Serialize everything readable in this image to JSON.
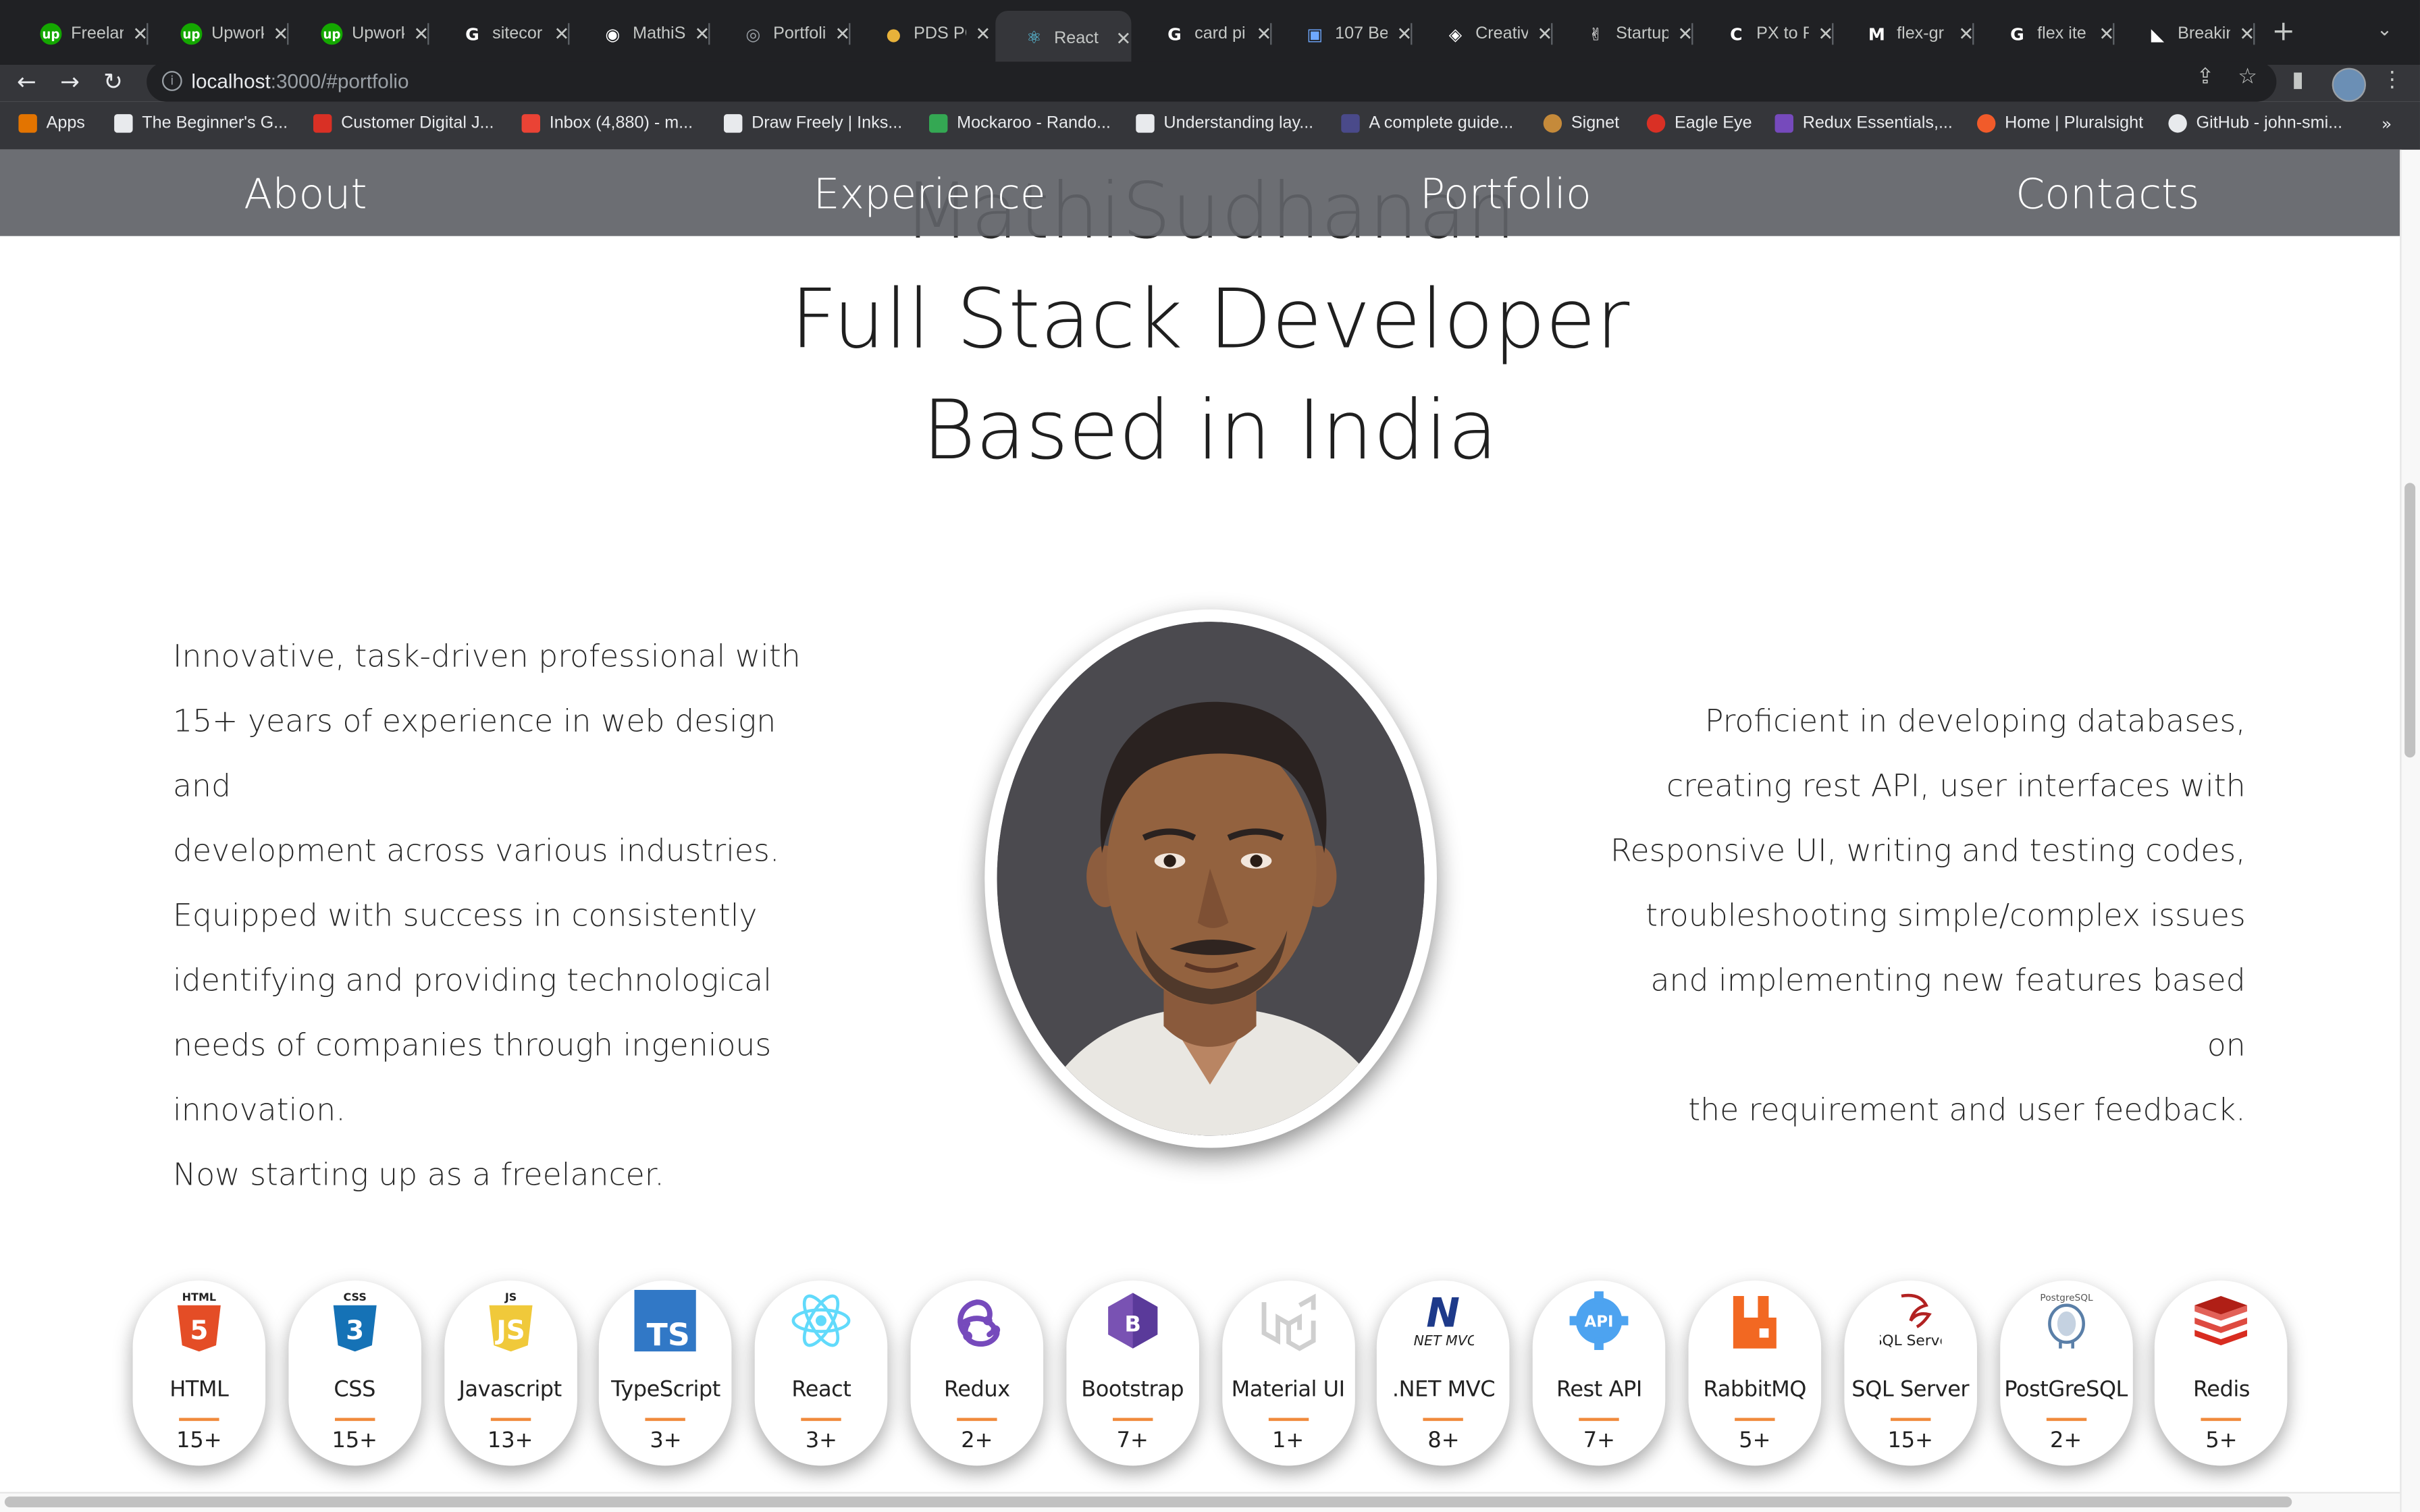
{
  "browser": {
    "tabs": [
      {
        "title": "Freelar",
        "icon": "upwork-icon",
        "color": "#14a800",
        "glyph": "up"
      },
      {
        "title": "Upwork",
        "icon": "upwork-icon",
        "color": "#14a800",
        "glyph": "up"
      },
      {
        "title": "Upwork",
        "icon": "upwork-icon",
        "color": "#14a800",
        "glyph": "up"
      },
      {
        "title": "sitecor",
        "icon": "google-icon",
        "color": "#ffffff",
        "glyph": "G"
      },
      {
        "title": "MathiS",
        "icon": "github-icon",
        "color": "#ffffff",
        "glyph": "◉"
      },
      {
        "title": "Portfoli",
        "icon": "globe-icon",
        "color": "#9aa0a6",
        "glyph": "◎"
      },
      {
        "title": "PDS PC",
        "icon": "pds-icon",
        "color": "#e8b23a",
        "glyph": "●"
      },
      {
        "title": "React",
        "icon": "react-icon",
        "color": "#61dafb",
        "glyph": "⚛"
      },
      {
        "title": "card pi",
        "icon": "google-icon",
        "color": "#ffffff",
        "glyph": "G"
      },
      {
        "title": "107 Be",
        "icon": "image-icon",
        "color": "#6ea8fe",
        "glyph": "▣"
      },
      {
        "title": "Creativ",
        "icon": "codepen-icon",
        "color": "#ffffff",
        "glyph": "◈"
      },
      {
        "title": "Startup",
        "icon": "startup-icon",
        "color": "#ffffff",
        "glyph": "✌"
      },
      {
        "title": "PX to R",
        "icon": "c-icon",
        "color": "#ffffff",
        "glyph": "C"
      },
      {
        "title": "flex-gr",
        "icon": "medium-icon",
        "color": "#ffffff",
        "glyph": "M"
      },
      {
        "title": "flex ite",
        "icon": "google-icon",
        "color": "#ffffff",
        "glyph": "G"
      },
      {
        "title": "Breakin",
        "icon": "breaking-icon",
        "color": "#ffffff",
        "glyph": "◣"
      }
    ],
    "active_tab_index": 7,
    "url_host": "localhost",
    "url_rest": ":3000/#portfolio",
    "bookmarks": [
      {
        "label": "Apps",
        "icon": "apps-grid-icon",
        "color": "#e37400"
      },
      {
        "label": "The Beginner's G...",
        "icon": "bookmark-icon",
        "color": "#e8eaed"
      },
      {
        "label": "Customer Digital J...",
        "icon": "bookmark-icon",
        "color": "#d93025"
      },
      {
        "label": "Inbox (4,880) - m...",
        "icon": "gmail-icon",
        "color": "#ea4335"
      },
      {
        "label": "Draw Freely | Inks...",
        "icon": "inkscape-icon",
        "color": "#e8eaed"
      },
      {
        "label": "Mockaroo - Rando...",
        "icon": "mockaroo-icon",
        "color": "#34a853"
      },
      {
        "label": "Understanding lay...",
        "icon": "bookmark-icon",
        "color": "#e8eaed"
      },
      {
        "label": "A complete guide...",
        "icon": "bookmark-icon",
        "color": "#4a4a8a"
      },
      {
        "label": "Signet",
        "icon": "signet-icon",
        "color": "#c58a3a"
      },
      {
        "label": "Eagle Eye",
        "icon": "eagle-icon",
        "color": "#d93025"
      },
      {
        "label": "Redux Essentials,...",
        "icon": "redux-icon",
        "color": "#764abc"
      },
      {
        "label": "Home | Pluralsight",
        "icon": "pluralsight-icon",
        "color": "#f15b2a"
      },
      {
        "label": "GitHub - john-smi...",
        "icon": "github-icon",
        "color": "#e8eaed"
      }
    ],
    "bookmarks_more": "»"
  },
  "site": {
    "name": "MathiSudhanan",
    "nav": [
      "About",
      "Experience",
      "Portfolio",
      "Contacts"
    ],
    "headline": [
      "Full Stack Developer",
      "Based in India"
    ],
    "intro_left": [
      "Innovative, task-driven professional with",
      "15+ years of experience in web design and",
      "development across various industries.",
      "Equipped with success in consistently",
      "identifying and providing technological",
      "needs of companies through ingenious",
      "innovation.",
      "Now starting up as a freelancer."
    ],
    "intro_right": [
      "Proficient in developing databases,",
      "creating rest API, user interfaces with",
      "Responsive UI, writing and testing codes,",
      "troubleshooting simple/complex issues",
      "and implementing new features based on",
      "the requirement and user feedback."
    ],
    "skills": [
      {
        "name": "HTML",
        "years": "15+",
        "icon": "html5-icon",
        "color": "#e44d26",
        "logo_text": "5"
      },
      {
        "name": "CSS",
        "years": "15+",
        "icon": "css3-icon",
        "color": "#1572b6",
        "logo_text": "3"
      },
      {
        "name": "Javascript",
        "years": "13+",
        "icon": "javascript-icon",
        "color": "#f0c93a",
        "logo_text": "JS"
      },
      {
        "name": "TypeScript",
        "years": "3+",
        "icon": "typescript-icon",
        "color": "#3178c6",
        "logo_text": "TS"
      },
      {
        "name": "React",
        "years": "3+",
        "icon": "react-icon",
        "color": "#61dafb",
        "logo_text": ""
      },
      {
        "name": "Redux",
        "years": "2+",
        "icon": "redux-icon",
        "color": "#764abc",
        "logo_text": ""
      },
      {
        "name": "Bootstrap",
        "years": "7+",
        "icon": "bootstrap-icon",
        "color": "#7952b3",
        "logo_text": "B"
      },
      {
        "name": "Material UI",
        "years": "1+",
        "icon": "material-ui-icon",
        "color": "#cfcfcf",
        "logo_text": ""
      },
      {
        "name": ".NET MVC",
        "years": "8+",
        "icon": "dotnet-mvc-icon",
        "color": "#1e3a8a",
        "logo_text": "N"
      },
      {
        "name": "Rest API",
        "years": "7+",
        "icon": "api-icon",
        "color": "#4da3f0",
        "logo_text": "API"
      },
      {
        "name": "RabbitMQ",
        "years": "5+",
        "icon": "rabbitmq-icon",
        "color": "#f26822",
        "logo_text": ""
      },
      {
        "name": "SQL Server",
        "years": "15+",
        "icon": "sql-server-icon",
        "color": "#b22222",
        "logo_text": "SQL Server"
      },
      {
        "name": "PostGreSQL",
        "years": "2+",
        "icon": "postgresql-icon",
        "color": "#5a7fa8",
        "logo_text": ""
      },
      {
        "name": "Redis",
        "years": "5+",
        "icon": "redis-icon",
        "color": "#d82c20",
        "logo_text": ""
      }
    ]
  }
}
